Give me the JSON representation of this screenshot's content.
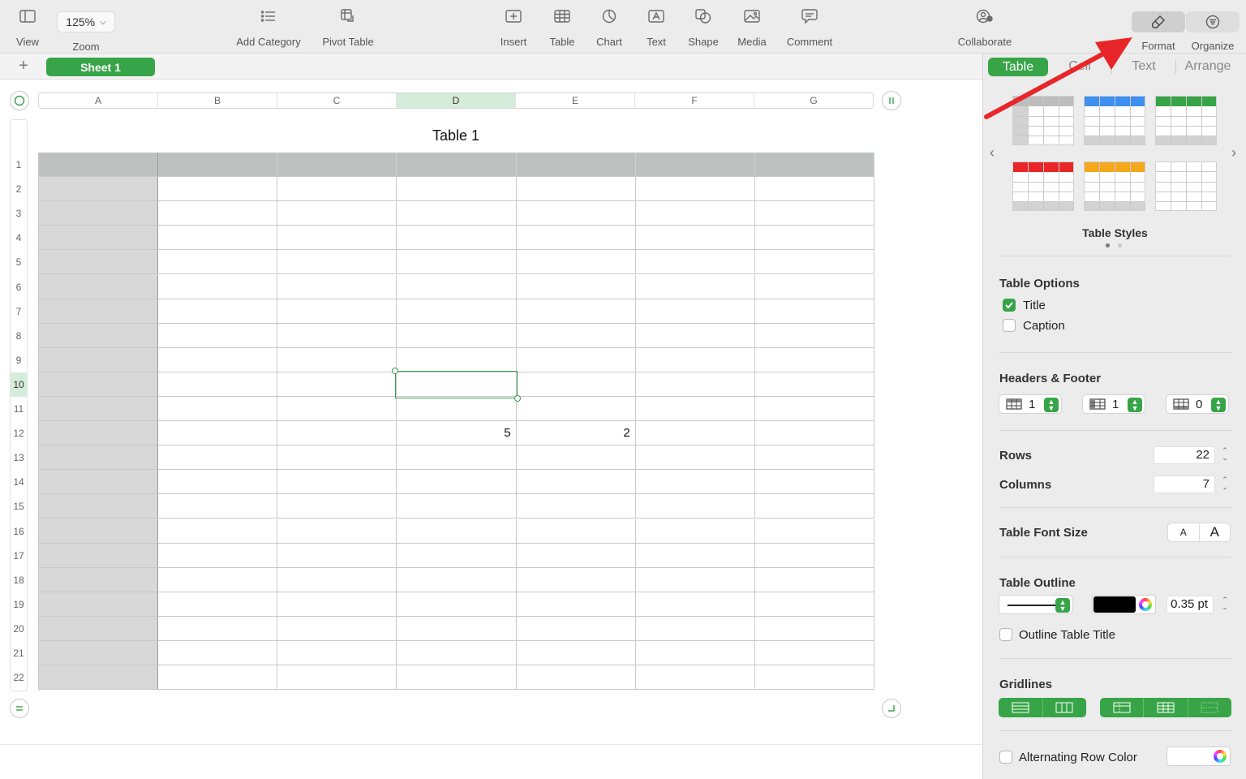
{
  "toolbar": {
    "view": "View",
    "zoom_value": "125%",
    "zoom": "Zoom",
    "add_category": "Add Category",
    "pivot_table": "Pivot Table",
    "insert": "Insert",
    "table": "Table",
    "chart": "Chart",
    "text": "Text",
    "shape": "Shape",
    "media": "Media",
    "comment": "Comment",
    "collaborate": "Collaborate",
    "format": "Format",
    "organize": "Organize"
  },
  "sheets": {
    "add": "+",
    "active_tab": "Sheet 1"
  },
  "table": {
    "title": "Table 1",
    "columns": [
      "A",
      "B",
      "C",
      "D",
      "E",
      "F",
      "G"
    ],
    "selected_column": "D",
    "rows": [
      "1",
      "2",
      "3",
      "4",
      "5",
      "6",
      "7",
      "8",
      "9",
      "10",
      "11",
      "12",
      "13",
      "14",
      "15",
      "16",
      "17",
      "18",
      "19",
      "20",
      "21",
      "22"
    ],
    "selected_row": "10",
    "cells": [
      {
        "row": 12,
        "col": "D",
        "value": "5"
      },
      {
        "row": 12,
        "col": "E",
        "value": "2"
      }
    ],
    "selected_cell": {
      "row": 10,
      "col": "D"
    }
  },
  "inspector": {
    "tabs": [
      "Table",
      "Cell",
      "Text",
      "Arrange"
    ],
    "active_tab": "Table",
    "table_styles_label": "Table Styles",
    "style_accents": [
      "#bdbdbd",
      "#3d8ff0",
      "#37a447",
      "#e8262a",
      "#f4a81c",
      "#ffffff"
    ],
    "table_options": {
      "heading": "Table Options",
      "title_label": "Title",
      "title_checked": true,
      "caption_label": "Caption",
      "caption_checked": false
    },
    "headers_footer": {
      "heading": "Headers & Footer",
      "header_rows": "1",
      "header_columns": "1",
      "footer_rows": "0"
    },
    "rows_label": "Rows",
    "rows_value": "22",
    "columns_label": "Columns",
    "columns_value": "7",
    "font_size_label": "Table Font Size",
    "font_small": "A",
    "font_large": "A",
    "outline": {
      "heading": "Table Outline",
      "color": "#000000",
      "width": "0.35 pt",
      "outline_title_label": "Outline Table Title",
      "outline_title_checked": false
    },
    "gridlines_label": "Gridlines",
    "alternating_label": "Alternating Row Color",
    "alternating_checked": false
  },
  "colors": {
    "accent_green": "#37a447",
    "annotation_red": "#e8262a"
  }
}
